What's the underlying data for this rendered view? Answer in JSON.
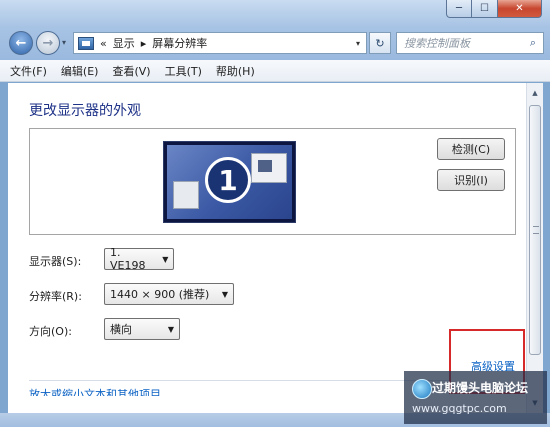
{
  "window": {
    "minimize_glyph": "─",
    "maximize_glyph": "☐",
    "close_glyph": "✕"
  },
  "nav": {
    "back_glyph": "←",
    "forward_glyph": "→",
    "history_glyph": "▾",
    "breadcrumb_prefix": "«",
    "breadcrumb": [
      "显示",
      "屏幕分辨率"
    ],
    "breadcrumb_sep": "▸",
    "refresh_glyph": "↻",
    "search_placeholder": "搜索控制面板",
    "search_glyph": "⌕"
  },
  "menu": [
    "文件(F)",
    "编辑(E)",
    "查看(V)",
    "工具(T)",
    "帮助(H)"
  ],
  "main": {
    "heading": "更改显示器的外观",
    "monitor_number": "1",
    "detect_button": "检测(C)",
    "identify_button": "识别(I)",
    "display_label": "显示器(S):",
    "display_value": "1. VE198",
    "resolution_label": "分辨率(R):",
    "resolution_value": "1440 × 900 (推荐)",
    "orientation_label": "方向(O):",
    "orientation_value": "横向",
    "advanced_link": "高级设置",
    "cut_link": "放大或缩小文本和其他项目"
  },
  "watermark": {
    "title": "过期馒头电脑论坛",
    "url": "www.gqgtpc.com"
  },
  "colors": {
    "heading": "#1e3287",
    "link": "#0b62c4",
    "highlight_box": "#d62a2a"
  }
}
